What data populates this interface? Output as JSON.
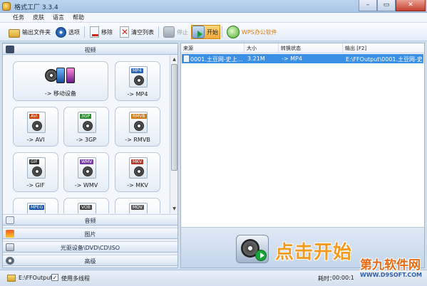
{
  "window": {
    "title": "格式工厂 3.3.4",
    "buttons": [
      "–",
      "▭",
      "✕"
    ]
  },
  "menu": [
    "任务",
    "皮肤",
    "语言",
    "帮助"
  ],
  "toolbar": {
    "output_folder": "输出文件夹",
    "options": "选项",
    "remove": "移除",
    "clear_list": "清空列表",
    "stop": "停止",
    "start": "开始",
    "wps": "WPS办公软件"
  },
  "categories": {
    "video": "视频",
    "audio": "音频",
    "image": "图片",
    "disc": "光驱设备\\DVD\\CD\\ISO",
    "advanced": "高级"
  },
  "video_formats": [
    {
      "label": "-> 移动设备",
      "tag": ""
    },
    {
      "label": "-> MP4",
      "tag": "MP4"
    },
    {
      "label": "-> AVI",
      "tag": "AVI"
    },
    {
      "label": "-> 3GP",
      "tag": "3GP"
    },
    {
      "label": "-> RMVB",
      "tag": "RMVB"
    },
    {
      "label": "-> GIF",
      "tag": "GIF"
    },
    {
      "label": "-> WMV",
      "tag": "WMV"
    },
    {
      "label": "-> MKV",
      "tag": "MKV"
    },
    {
      "label": "",
      "tag": "MPEG"
    },
    {
      "label": "",
      "tag": "VOB"
    },
    {
      "label": "",
      "tag": "MOV"
    }
  ],
  "task_list": {
    "columns": [
      "来源",
      "大小",
      "转换状态",
      "输出 [F2]"
    ],
    "rows": [
      {
        "source": "0001.土豆网-史上...",
        "size": "3.21M",
        "status": "-> MP4",
        "output": "E:\\FFOutput\\0001.土豆网-史上最"
      }
    ]
  },
  "banner": {
    "text": "点击开始"
  },
  "status": {
    "output_path": "E:\\FFOutput",
    "multithread_label": "使用多线程",
    "multithread_checked": "✓",
    "time_label": "耗时：",
    "time_value": "00:00:1"
  },
  "watermark": {
    "main": "第九软件网",
    "sub": "WWW.D9SOFT.COM"
  },
  "colors": {
    "accent": "#3b8fe5",
    "start_button": "#f2a93a",
    "banner_text": "#f39a1f"
  }
}
